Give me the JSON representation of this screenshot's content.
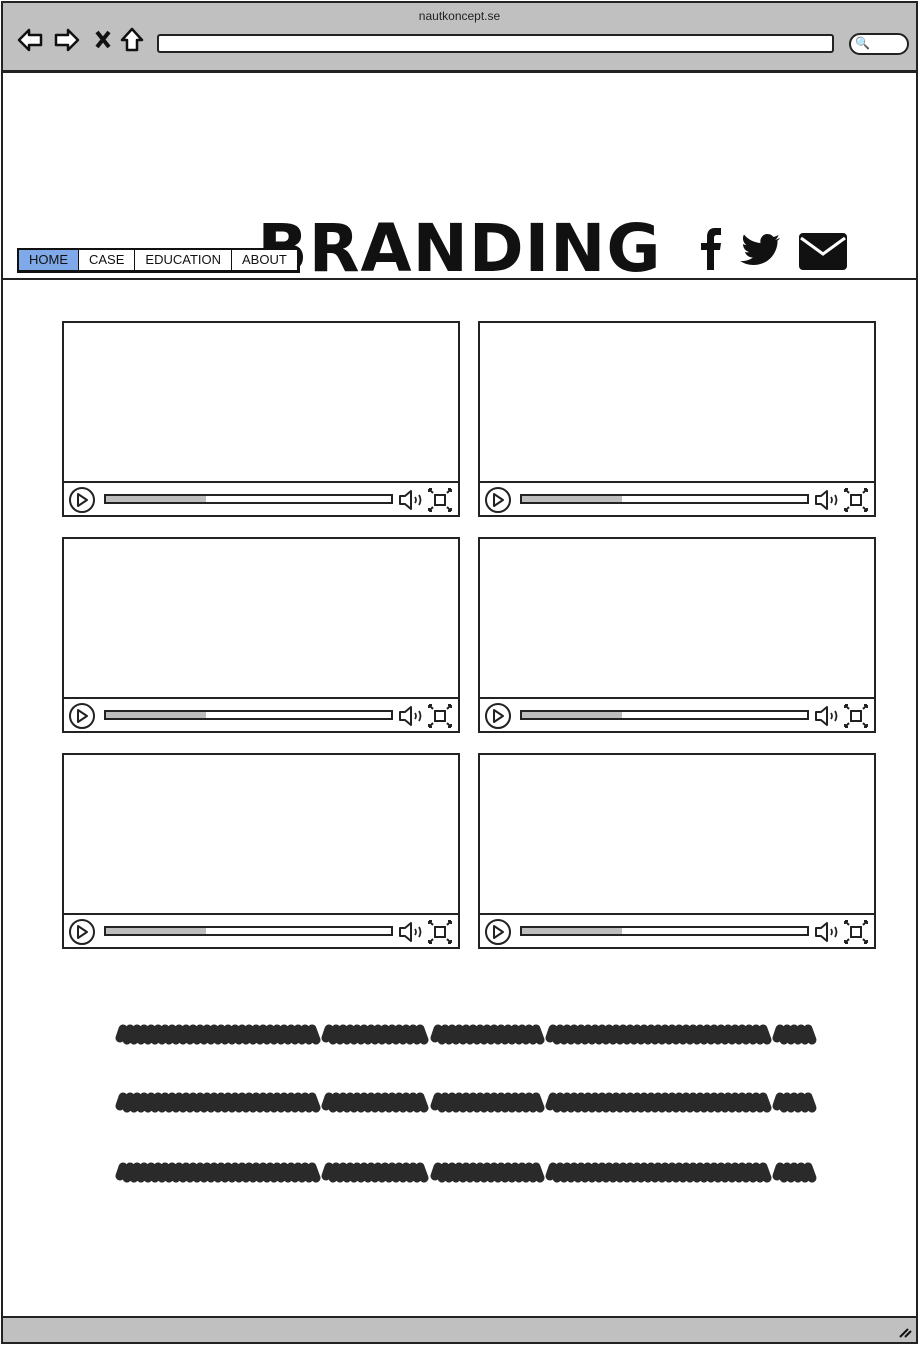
{
  "browser": {
    "url_title": "nautkoncept.se",
    "address_value": "",
    "icons": [
      "back-arrow-icon",
      "forward-arrow-icon",
      "close-icon",
      "home-icon",
      "search-icon"
    ]
  },
  "header": {
    "brand": "BRANDING",
    "tabs": [
      {
        "label": "HOME",
        "active": true
      },
      {
        "label": "CASE",
        "active": false
      },
      {
        "label": "EDUCATION",
        "active": false
      },
      {
        "label": "ABOUT",
        "active": false
      }
    ],
    "social": [
      "facebook-icon",
      "twitter-icon",
      "mail-icon"
    ]
  },
  "videos": [
    {
      "progress": 0.35
    },
    {
      "progress": 0.35
    },
    {
      "progress": 0.35
    },
    {
      "progress": 0.35
    },
    {
      "progress": 0.35
    },
    {
      "progress": 0.35
    }
  ],
  "colors": {
    "active_tab": "#7fa9e8",
    "chrome": "#c0c0c0",
    "progress_fill": "#bdbdbd",
    "scribble": "#2a2a2a"
  }
}
